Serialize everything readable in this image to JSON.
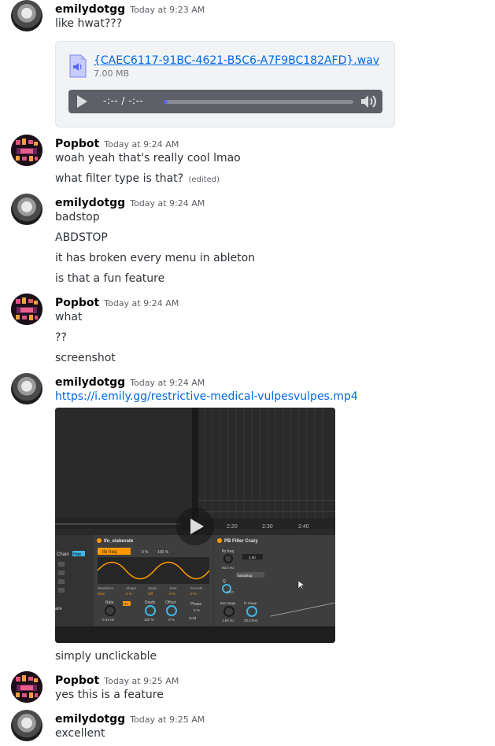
{
  "messages": [
    {
      "author": "emilydotgg",
      "time": "Today at 9:23 AM",
      "lines": [
        "like hwat???"
      ],
      "attachment": {
        "file_name": "{CAEC6117-91BC-4621-B5C6-A7F9BC182AFD}.wav",
        "file_size": "7.00 MB",
        "time_display": "-:-- / -:--",
        "progress": 0.02
      }
    },
    {
      "author": "Popbot",
      "time": "Today at 9:24 AM",
      "lines": [
        "woah yeah that's really cool lmao",
        "what filter type is that?"
      ],
      "edited": "(edited)"
    },
    {
      "author": "emilydotgg",
      "time": "Today at 9:24 AM",
      "lines": [
        "badstop",
        "ABDSTOP",
        "it has broken every menu in ableton",
        "is that a fun feature"
      ]
    },
    {
      "author": "Popbot",
      "time": "Today at 9:24 AM",
      "lines": [
        "what",
        "??",
        "screenshot"
      ]
    },
    {
      "author": "emilydotgg",
      "time": "Today at 9:24 AM",
      "link": "https://i.emily.gg/restrictive-medical-vulpesvulpes.mp4",
      "video": {
        "timeline_labels": [
          "2:20",
          "2:30",
          "2:40"
        ],
        "device_chain": "Chain",
        "device_hide": "Hide",
        "lfo_title": "lfo_elaborate",
        "lfo_target": "lfo freq",
        "lfo_values": [
          "0 %",
          "100 %"
        ],
        "lfo_params": [
          "Waveform",
          "Shape",
          "Steps",
          "Jitter",
          "Smooth"
        ],
        "lfo_param_values": [
          "Sine",
          "0 %",
          "Off",
          "0 %",
          "0 %"
        ],
        "lfo_knobs": [
          "Rate",
          "Depth",
          "Offset",
          "Phase"
        ],
        "lfo_knob_values": [
          "0.41 Hz",
          "100 %",
          "0 %",
          "0 %"
        ],
        "lfo_mode": "Hz",
        "lfo_hold": "Hold",
        "filter_title": "PB Filter Crazy",
        "filter_labels": [
          "lfo freq",
          "Q",
          "low range",
          "hi range"
        ],
        "filter_values": [
          "93.0 Hz",
          "1.00",
          "40.0",
          "1.60 Hz",
          "20.0 kHz"
        ],
        "filter_type": "bandstop",
        "side_label": "are"
      },
      "lines": [
        "simply unclickable"
      ]
    },
    {
      "author": "Popbot",
      "time": "Today at 9:25 AM",
      "lines": [
        "yes this is a feature"
      ]
    },
    {
      "author": "emilydotgg",
      "time": "Today at 9:25 AM",
      "lines": [
        "excellent"
      ]
    }
  ],
  "colors": {
    "link": "#0068e0",
    "username": "#060607",
    "text": "#2e3338",
    "timestamp": "#5c5e66",
    "audio_bar": "#5d6066",
    "progress": "#5865f2",
    "ableton_orange": "#ff9900",
    "ableton_blue": "#3fb6e6"
  },
  "icons": [
    "audio-file-icon",
    "play-icon",
    "volume-icon",
    "video-play-icon",
    "mouse-cursor-icon"
  ]
}
